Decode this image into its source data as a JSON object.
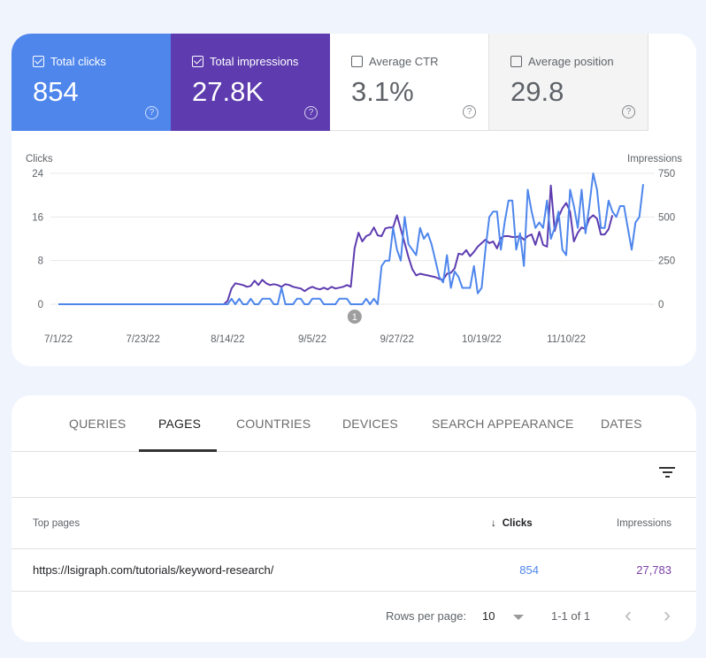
{
  "metrics": [
    {
      "id": "clicks",
      "label": "Total clicks",
      "value": "854",
      "checked": true,
      "color": "#4e86ec"
    },
    {
      "id": "impressions",
      "label": "Total impressions",
      "value": "27.8K",
      "checked": true,
      "color": "#5e3caf"
    },
    {
      "id": "ctr",
      "label": "Average CTR",
      "value": "3.1%",
      "checked": false
    },
    {
      "id": "position",
      "label": "Average position",
      "value": "29.8",
      "checked": false
    }
  ],
  "help_glyph": "?",
  "chart_data": {
    "type": "line",
    "left_axis_label": "Clicks",
    "right_axis_label": "Impressions",
    "left_ticks": [
      "0",
      "8",
      "16",
      "24"
    ],
    "right_ticks": [
      "0",
      "250",
      "500",
      "750"
    ],
    "left_ylim": [
      0,
      24
    ],
    "right_ylim": [
      0,
      750
    ],
    "x_tick_labels": [
      "7/1/22",
      "7/23/22",
      "8/14/22",
      "9/5/22",
      "9/27/22",
      "10/19/22",
      "11/10/22"
    ],
    "grid": true,
    "annotation": {
      "label": "1",
      "date": "9/16/22"
    },
    "series": [
      {
        "name": "Clicks",
        "axis": "left",
        "color": "#4e86ec",
        "values": [
          0,
          0,
          0,
          0,
          0,
          0,
          0,
          0,
          0,
          0,
          0,
          0,
          0,
          0,
          0,
          0,
          0,
          0,
          0,
          0,
          0,
          0,
          0,
          0,
          0,
          0,
          0,
          0,
          0,
          0,
          0,
          0,
          0,
          0,
          0,
          0,
          0,
          0,
          0,
          0,
          0,
          0,
          0,
          0,
          0,
          1,
          0,
          1,
          0,
          0,
          1,
          0,
          0,
          1,
          1,
          1,
          0,
          0,
          3,
          0,
          0,
          0,
          1,
          1,
          0,
          0,
          1,
          1,
          1,
          0,
          0,
          0,
          0,
          1,
          1,
          1,
          0,
          0,
          0,
          0,
          1,
          0,
          1,
          0,
          7,
          8,
          8,
          14,
          10,
          8,
          16,
          11,
          10,
          9,
          14,
          12,
          13,
          11,
          8,
          5,
          4,
          9,
          3,
          6,
          5,
          3,
          3,
          3,
          7,
          2,
          3,
          10,
          16,
          17,
          17,
          10,
          15,
          19,
          19,
          10,
          13,
          7,
          21,
          17,
          14,
          15,
          14,
          19,
          12,
          14,
          17,
          10,
          9,
          21,
          18,
          14,
          21,
          13,
          18,
          24,
          21,
          14,
          14,
          19,
          17,
          16,
          18,
          18,
          14,
          10,
          15,
          16,
          22
        ]
      },
      {
        "name": "Impressions",
        "axis": "right",
        "color": "#5e3caf",
        "values": [
          0,
          0,
          0,
          0,
          0,
          0,
          0,
          0,
          0,
          0,
          0,
          0,
          0,
          0,
          0,
          0,
          0,
          0,
          0,
          0,
          0,
          0,
          0,
          0,
          0,
          0,
          0,
          0,
          0,
          0,
          0,
          0,
          0,
          0,
          0,
          0,
          0,
          0,
          0,
          0,
          0,
          0,
          0,
          0,
          20,
          90,
          120,
          115,
          110,
          100,
          105,
          135,
          110,
          140,
          120,
          110,
          115,
          110,
          100,
          115,
          110,
          100,
          95,
          90,
          75,
          90,
          100,
          90,
          85,
          95,
          85,
          100,
          90,
          95,
          100,
          110,
          100,
          320,
          410,
          360,
          390,
          400,
          440,
          395,
          390,
          435,
          440,
          440,
          510,
          430,
          350,
          270,
          200,
          165,
          175,
          170,
          165,
          160,
          155,
          145,
          140,
          175,
          180,
          205,
          290,
          285,
          310,
          275,
          300,
          330,
          350,
          370,
          350,
          360,
          320,
          380,
          390,
          390,
          385,
          385,
          390,
          370,
          390,
          400,
          340,
          415,
          340,
          330,
          680,
          420,
          500,
          550,
          580,
          530,
          360,
          410,
          440,
          430,
          490,
          510,
          490,
          400,
          400,
          430,
          510
        ]
      }
    ]
  },
  "tabs": [
    {
      "label": "QUERIES",
      "active": false
    },
    {
      "label": "PAGES",
      "active": true
    },
    {
      "label": "COUNTRIES",
      "active": false
    },
    {
      "label": "DEVICES",
      "active": false
    },
    {
      "label": "SEARCH APPEARANCE",
      "active": false
    },
    {
      "label": "DATES",
      "active": false
    }
  ],
  "table": {
    "columns": {
      "page": "Top pages",
      "clicks": "Clicks",
      "impressions": "Impressions"
    },
    "sort_icon": "↓",
    "rows": [
      {
        "page": "https://lsigraph.com/tutorials/keyword-research/",
        "clicks": "854",
        "impressions": "27,783"
      }
    ],
    "clicks_color": "#4e86ec",
    "impressions_color": "#7b3fa6"
  },
  "pagination": {
    "rows_per_page_label": "Rows per page:",
    "rows_per_page_value": "10",
    "range": "1-1 of 1",
    "prev": "‹",
    "next": "›"
  }
}
